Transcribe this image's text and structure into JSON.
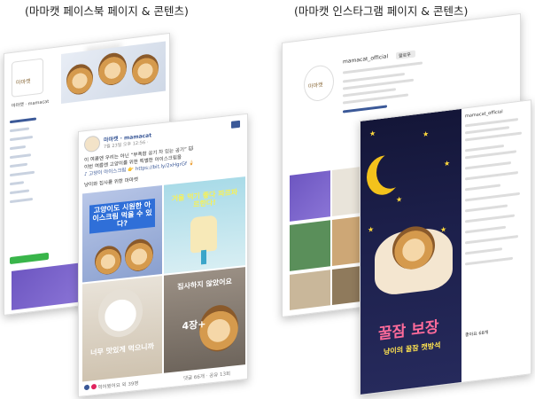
{
  "captions": {
    "facebook": "(마마캣 페이스북 페이지 & 콘텐츠)",
    "instagram": "(마마캣 인스타그램 페이지 & 콘텐츠)"
  },
  "facebook": {
    "page_name": "마마캣",
    "profile_line": "마마캣 · mamacat",
    "post": {
      "author": "마마캣 · mamacat",
      "date": "7월 23일 오후 12:56 · ",
      "body_lines": [
        "이 여름엔 우리는 아닌 “부족함 공기 차 있는 공기” 🐱",
        "이번 여름엔 고양이를 위한 특별한 아이스크림을",
        "♪ 고양이 아이스크림 👉 https://bit.ly/2xHgrGf 🍦",
        "냥이와 집사를 위한 마마캣"
      ],
      "tiles": [
        "고양이도 시원한 아이스크림 먹을 수 있다?",
        "겨울 먹기 좋다 파르파르한다!",
        "너무 맛있게 먹으니까",
        "집사하지 않았어요",
        "4장+"
      ],
      "footer_left": "먹어봤어요 외 39명",
      "footer_right": "댓글 66개 · 공유 13회"
    }
  },
  "instagram": {
    "handle": "mamacat_official",
    "profile_name": "마마캣",
    "follow_label": "팔로우",
    "post_title": "꿀잠 보장",
    "post_sub": "냥이의 꿀잠 캣방석",
    "comment_user": "mamacat_official",
    "likes": "좋아요 68개"
  },
  "colors": {
    "fb_blue": "#3b5998",
    "fb_green": "#39b54a",
    "night": "#1c1f4a",
    "moon": "#f3c21c",
    "highlight_yellow": "#f4f05c",
    "tile_blue": "#2f6fd8",
    "tile_purple": "#6d56c1"
  }
}
